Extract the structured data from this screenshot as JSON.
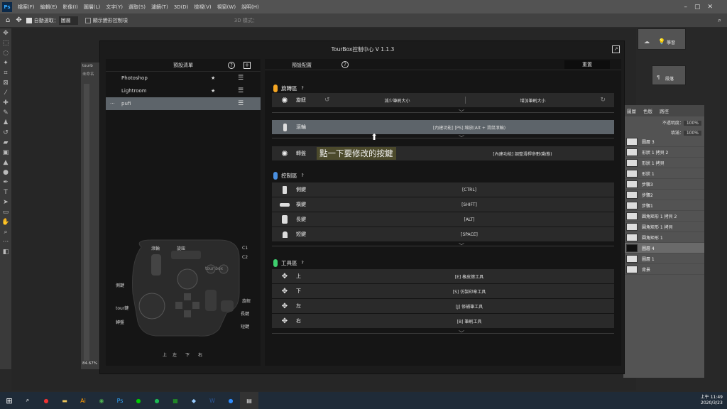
{
  "ps": {
    "logo": "Ps",
    "menus": [
      "檔案(F)",
      "編輯(E)",
      "影像(I)",
      "圖層(L)",
      "文字(Y)",
      "選取(S)",
      "濾鏡(T)",
      "3D(D)",
      "檢視(V)",
      "視窗(W)",
      "說明(H)"
    ],
    "auto_select": "自動選取：",
    "auto_select_value": "圖層",
    "transform_label": "顯示變形控制項",
    "mode_3d": "3D 模式：",
    "zoom": "84.67%",
    "doc_tab": "tourb",
    "doc_tab2": "未命名",
    "panel1": "學習",
    "panel2": "段落",
    "layer_tabs": [
      "圖層",
      "色版",
      "路徑"
    ],
    "opacity_label": "不透明度：",
    "opacity": "100%",
    "fill_label": "填滿：",
    "fill": "100%",
    "layers": [
      "圖層 3",
      "形狀 1 拷貝 2",
      "形狀 1 拷貝",
      "形狀 1",
      "步驟3",
      "步驟2",
      "步驟1",
      "圓角矩形 1 拷貝 2",
      "圓角矩形 1 拷貝",
      "圓角矩形 1",
      "圖層 4",
      "圖層 1",
      "背景"
    ],
    "selected_layer_index": 10
  },
  "taskbar": {
    "time": "上午 11:49",
    "date": "2020/3/23"
  },
  "tourbox": {
    "title": "TourBox控制中心 V 1.1.3",
    "preset_header": "預設清單",
    "presets": [
      "Photoshop",
      "Lightroom",
      "pufi"
    ],
    "active_preset": 2,
    "active_prefix": "···",
    "diagram_labels": {
      "roller": "滾輪",
      "knob": "旋鈕",
      "c1": "C1",
      "c2": "C2",
      "side": "側鍵",
      "tour": "tour鍵",
      "wheel": "轉盤",
      "tall": "長鍵",
      "short": "短鍵",
      "up": "上",
      "left": "左",
      "down": "下",
      "right": "右",
      "dial": "旋鈕",
      "brand": "tour box"
    },
    "config_tab": "預設配置",
    "reset": "重置",
    "annotation": "點一下要修改的按鍵",
    "sections": {
      "rotation": {
        "title": "旋轉區",
        "color": "#f5a623"
      },
      "control": {
        "title": "控制區",
        "color": "#4a90e2"
      },
      "tool": {
        "title": "工具區",
        "color": "#3ecf6e"
      }
    },
    "rotation_rows": [
      {
        "label": "旋鈕",
        "left": "減少筆刷大小",
        "right": "增加筆刷大小"
      },
      {
        "label": "滾輪",
        "value": "[內建功能] [PS] 縮放(Alt + 滑鼠滾輪)"
      },
      {
        "label": "轉盤",
        "value": "[內建功能] 調整滑桿參數(動態)"
      }
    ],
    "control_rows": [
      {
        "label": "側鍵",
        "value": "[CTRL]"
      },
      {
        "label": "橫鍵",
        "value": "[SHIFT]"
      },
      {
        "label": "長鍵",
        "value": "[ALT]"
      },
      {
        "label": "短鍵",
        "value": "[SPACE]"
      }
    ],
    "tool_rows": [
      {
        "label": "上",
        "value": "[E] 橡皮擦工具"
      },
      {
        "label": "下",
        "value": "[S] 仿製印章工具"
      },
      {
        "label": "左",
        "value": "[J] 修補筆工具"
      },
      {
        "label": "右",
        "value": "[B] 筆刷工具"
      }
    ]
  }
}
